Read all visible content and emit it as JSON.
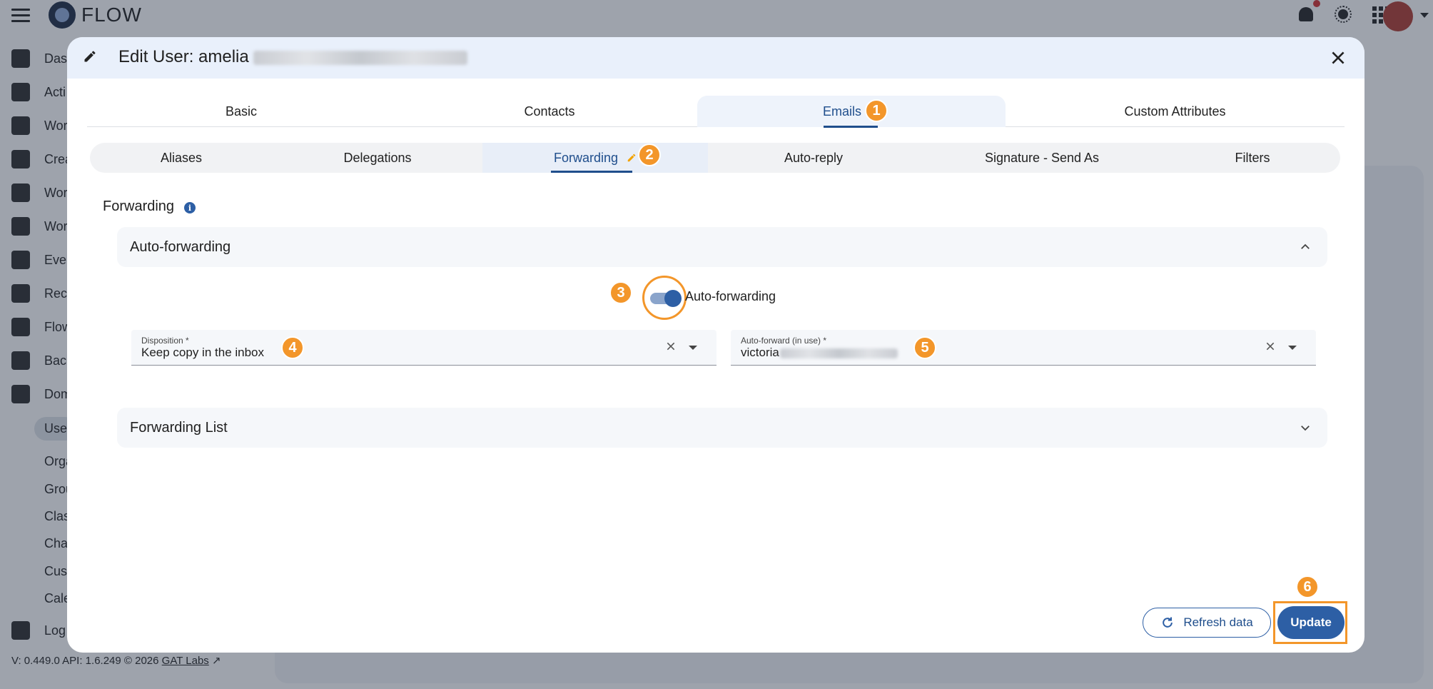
{
  "app": {
    "logo_text": "FLOW",
    "nav_items": [
      "Das",
      "Acti",
      "Wor",
      "Crea",
      "Wor",
      "Wor",
      "Ever",
      "Recc",
      "Flow",
      "Back",
      "Dom"
    ],
    "nav_sub_items": [
      "Use",
      "Orga",
      "Grou",
      "Clas",
      "Cha",
      "Cus",
      "Cale"
    ],
    "nav_logs": "Log",
    "version_text": "V: 0.449.0  API: 1.6.249  © 2026",
    "version_link": "GAT Labs"
  },
  "dialog": {
    "title": "Edit User: amelia",
    "main_tabs": [
      {
        "label": "Basic"
      },
      {
        "label": "Contacts"
      },
      {
        "label": "Emails"
      },
      {
        "label": "Custom Attributes"
      }
    ],
    "sub_tabs": [
      {
        "label": "Aliases"
      },
      {
        "label": "Delegations"
      },
      {
        "label": "Forwarding"
      },
      {
        "label": "Auto-reply"
      },
      {
        "label": "Signature - Send As"
      },
      {
        "label": "Filters"
      }
    ],
    "section_title": "Forwarding",
    "auto_forwarding_panel": {
      "title": "Auto-forwarding",
      "toggle_label": "Auto-forwarding",
      "toggle_on": true,
      "disposition": {
        "label": "Disposition *",
        "value": "Keep copy in the inbox"
      },
      "auto_forward": {
        "label": "Auto-forward (in use) *",
        "value": "victoria"
      }
    },
    "forwarding_list_panel": {
      "title": "Forwarding List"
    },
    "buttons": {
      "refresh": "Refresh data",
      "update": "Update"
    }
  },
  "annotations": [
    "1",
    "2",
    "3",
    "4",
    "5",
    "6"
  ],
  "colors": {
    "accent": "#2d5fa5",
    "annotation": "#f3962a",
    "header_bg": "#e9f0fb"
  }
}
